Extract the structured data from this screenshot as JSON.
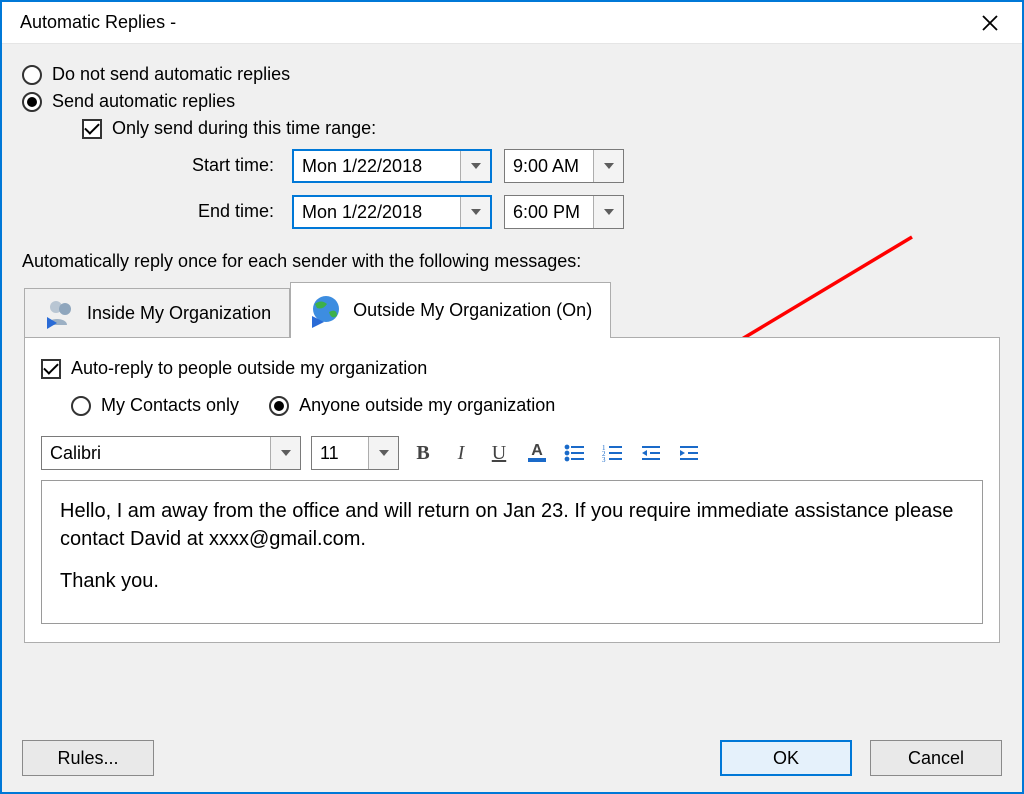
{
  "window": {
    "title": "Automatic Replies -"
  },
  "options": {
    "do_not_send": "Do not send automatic replies",
    "send": "Send automatic replies",
    "only_range": "Only send during this time range:"
  },
  "time": {
    "start_label": "Start time:",
    "end_label": "End time:",
    "start_date": "Mon 1/22/2018",
    "start_time": "9:00 AM",
    "end_date": "Mon 1/22/2018",
    "end_time": "6:00 PM"
  },
  "instruction": "Automatically reply once for each sender with the following messages:",
  "tabs": {
    "inside": "Inside My Organization",
    "outside": "Outside My Organization (On)"
  },
  "outside": {
    "enable": "Auto-reply to people outside my organization",
    "contacts_only": "My Contacts only",
    "anyone": "Anyone outside my organization"
  },
  "format": {
    "font": "Calibri",
    "size": "11"
  },
  "message": {
    "p1": "Hello, I am away from the office and will return on Jan 23. If you require immediate assistance please contact David at xxxx@gmail.com.",
    "p2": "Thank you."
  },
  "buttons": {
    "rules": "Rules...",
    "ok": "OK",
    "cancel": "Cancel"
  }
}
